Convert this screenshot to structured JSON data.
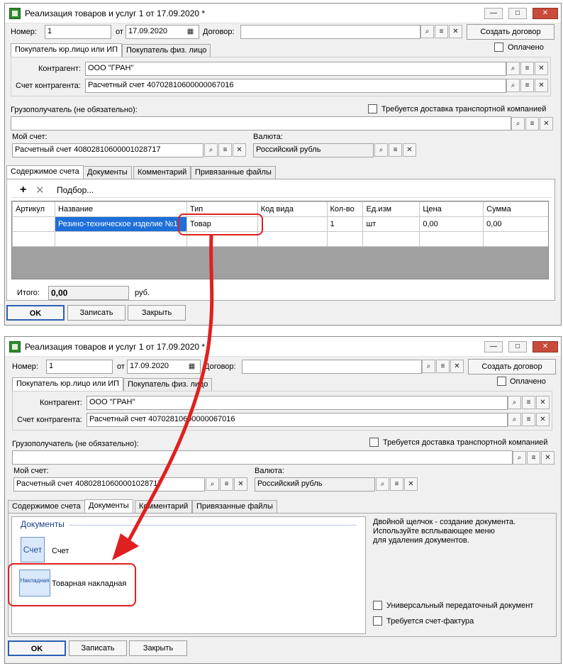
{
  "window_title": "Реализация товаров и услуг 1 от 17.09.2020 *",
  "title_buttons": {
    "minimize": "—",
    "maximize": "□",
    "close": "✕"
  },
  "labels": {
    "number": "Номер:",
    "from": "от",
    "contract": "Договор:",
    "create_contract": "Создать договор",
    "paid": "Оплачено",
    "counterparty": "Контрагент:",
    "counterparty_account": "Счет контрагента:",
    "consignee": "Грузополучатель (не обязательно):",
    "delivery_required": "Требуется доставка транспортной компанией",
    "my_account": "Мой счет:",
    "currency": "Валюта:",
    "total": "Итого:",
    "rub": "руб."
  },
  "values": {
    "number": "1",
    "date": "17.09.2020",
    "contract": "",
    "counterparty": "ООО \"ГРАН\"",
    "counterparty_account": "Расчетный счет 40702810600000067016",
    "consignee": "",
    "my_account": "Расчетный счет 40802810600001028717",
    "currency": "Российский рубль",
    "total": "0,00"
  },
  "buyer_tabs": [
    "Покупатель юр.лицо или ИП",
    "Покупатель физ. лицо"
  ],
  "content_tabs": [
    "Содержимое счета",
    "Документы",
    "Комментарий",
    "Привязанные файлы"
  ],
  "toolbar": {
    "add": "+",
    "delete": "✕",
    "select": "Подбор..."
  },
  "table": {
    "headers": [
      "Артикул",
      "Название",
      "Тип",
      "Код вида",
      "Кол-во",
      "Ед.изм",
      "Цена",
      "Сумма"
    ],
    "rows": [
      [
        "",
        "Резино-техническое изделие №1",
        "Товар",
        "",
        "1",
        "шт",
        "0,00",
        "0,00"
      ]
    ]
  },
  "footer": {
    "ok": "OK",
    "save": "Записать",
    "close": "Закрыть"
  },
  "documents": {
    "group_title": "Документы",
    "items": [
      {
        "label": "Счет",
        "icon_text": "Счет"
      },
      {
        "label": "Товарная накладная",
        "icon_text": "Накладная"
      }
    ],
    "hint": [
      "Двойной щелчок - создание документа.",
      "Используйте всплывающее меню",
      "для удаления документов."
    ],
    "upd": "Универсальный передаточный документ",
    "invoice_required": "Требуется счет-фактура"
  },
  "colors": {
    "annotation": "#e02020",
    "selection": "#1e6fd9"
  }
}
